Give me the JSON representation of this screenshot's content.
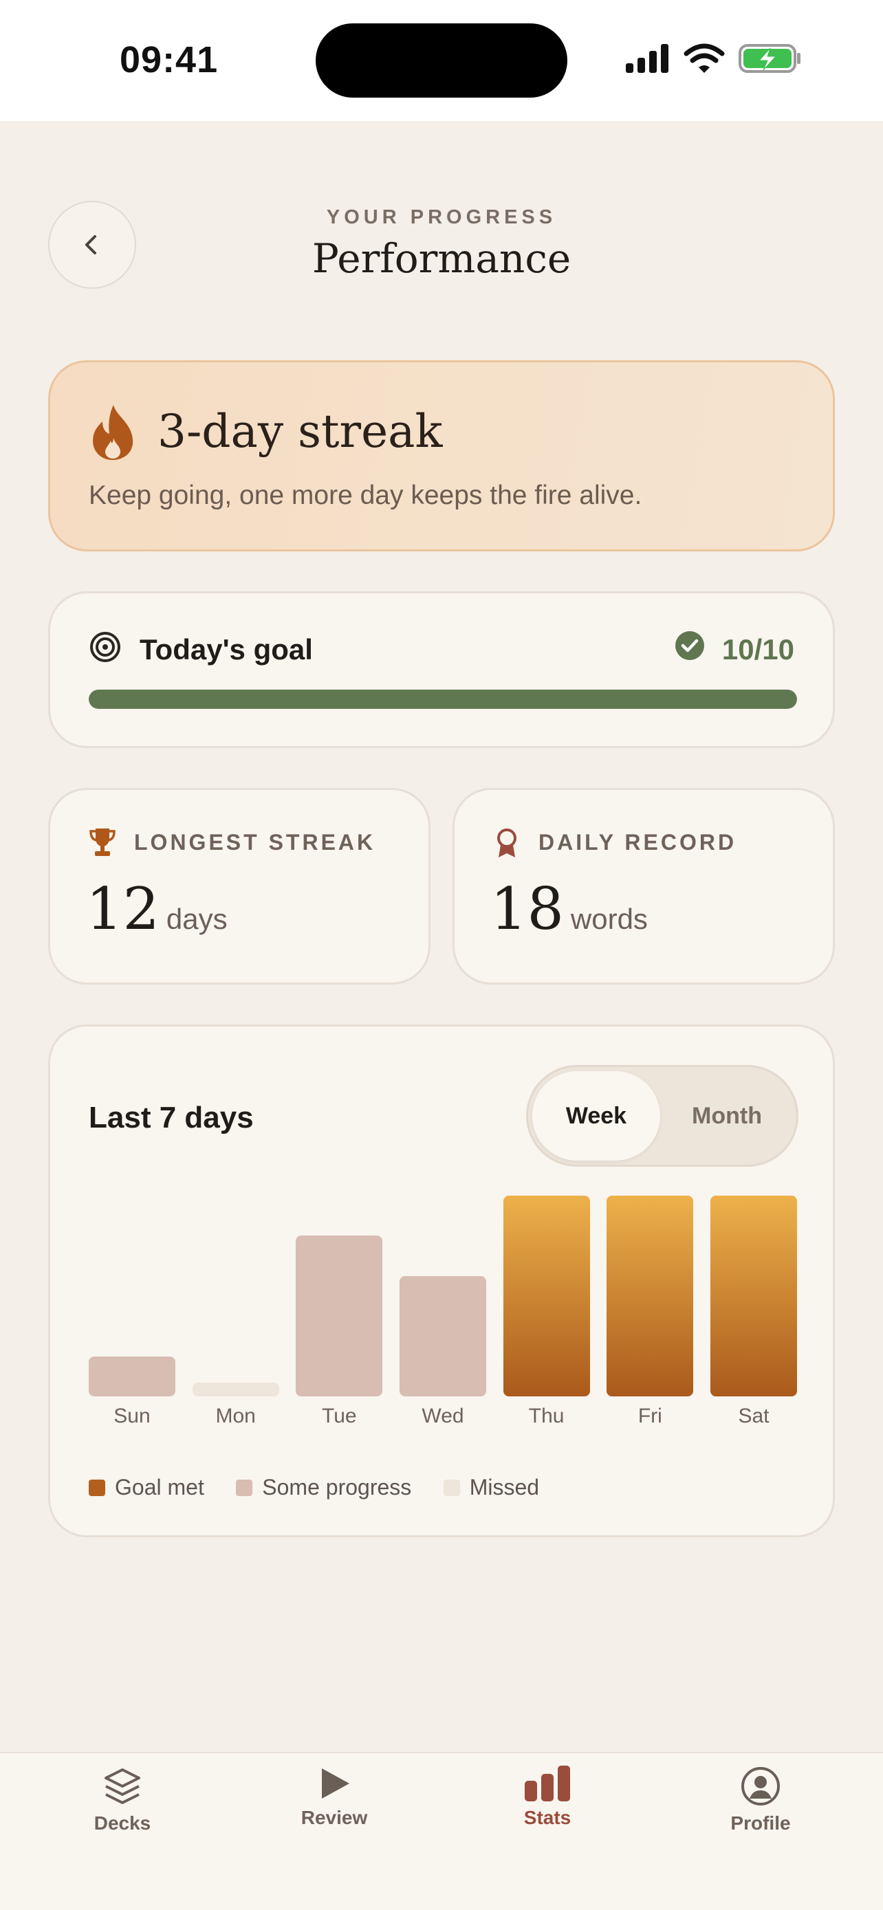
{
  "status_bar": {
    "time": "09:41"
  },
  "header": {
    "eyebrow": "YOUR PROGRESS",
    "title": "Performance"
  },
  "streak": {
    "title": "3-day streak",
    "subtitle": "Keep going, one more day keeps the fire alive."
  },
  "goal": {
    "label": "Today's goal",
    "value": "10/10",
    "progress": 1.0
  },
  "stats": [
    {
      "label": "LONGEST STREAK",
      "value": "12",
      "unit": "days"
    },
    {
      "label": "DAILY RECORD",
      "value": "18",
      "unit": "words"
    }
  ],
  "chart": {
    "title": "Last 7 days",
    "segments": [
      "Week",
      "Month"
    ],
    "selected_segment": "Week",
    "legend": [
      "Goal met",
      "Some progress",
      "Missed"
    ]
  },
  "chart_data": {
    "type": "bar",
    "categories": [
      "Sun",
      "Mon",
      "Tue",
      "Wed",
      "Thu",
      "Fri",
      "Sat"
    ],
    "values": [
      2,
      0,
      8,
      6,
      10,
      10,
      10
    ],
    "status": [
      "some",
      "missed",
      "some",
      "some",
      "met",
      "met",
      "met"
    ],
    "ylim": [
      0,
      10
    ],
    "colors": {
      "met": "#b3601e",
      "some": "#d8bdb3",
      "missed": "#eee6da"
    }
  },
  "tabbar": {
    "items": [
      {
        "label": "Decks"
      },
      {
        "label": "Review"
      },
      {
        "label": "Stats"
      },
      {
        "label": "Profile"
      }
    ],
    "active": "Stats"
  },
  "colors": {
    "background": "#f4efe8",
    "accent_green": "#607852",
    "accent_orange": "#b3601e",
    "accent_brick": "#9a4c3d"
  }
}
